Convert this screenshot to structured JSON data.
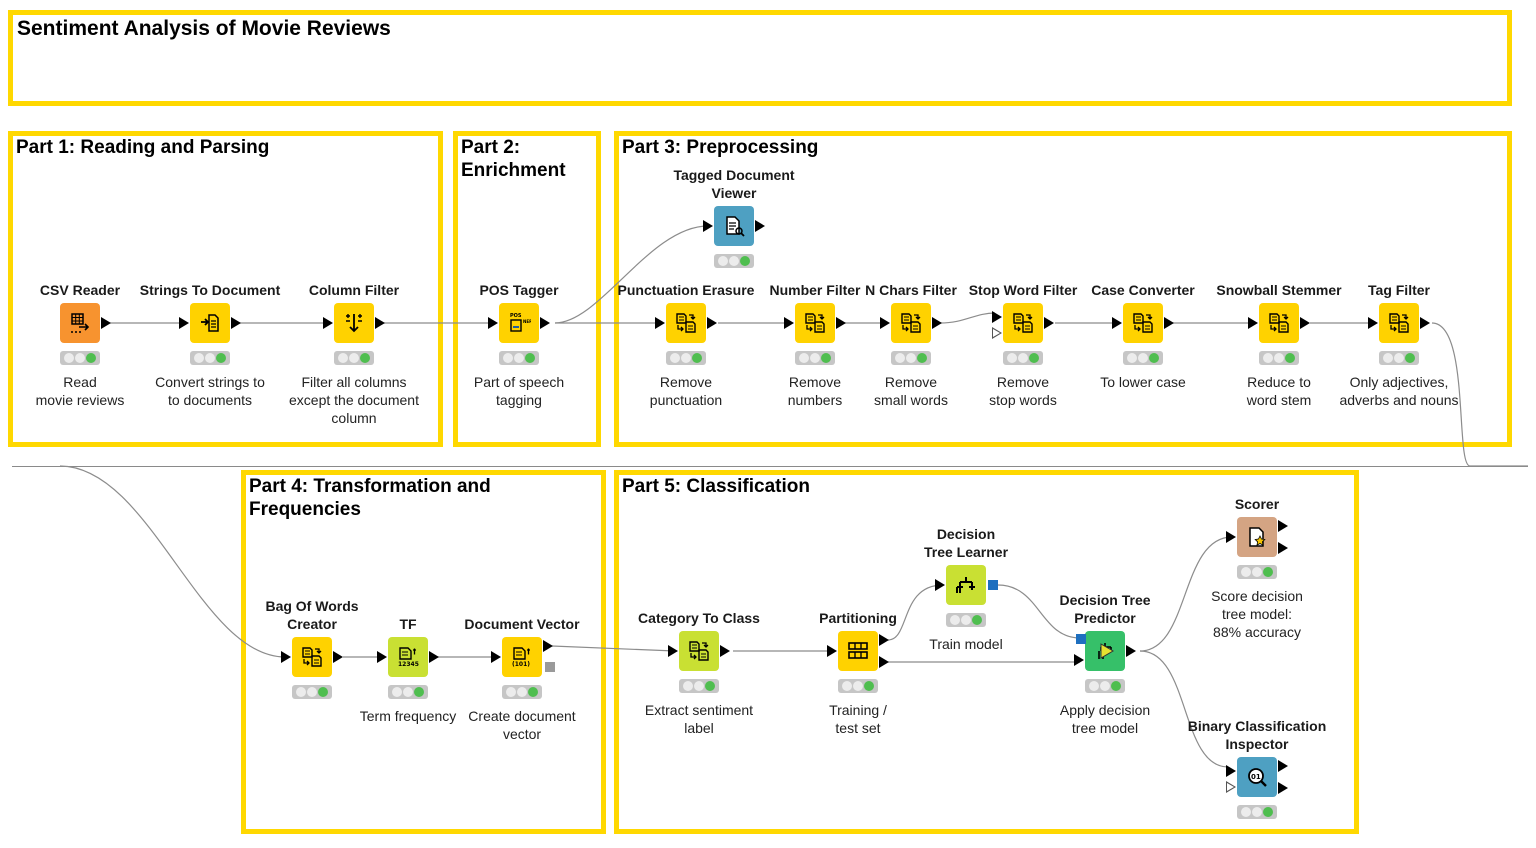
{
  "workflow": {
    "title": "Sentiment Analysis of Movie Reviews",
    "annotation_color": "#ffd800"
  },
  "annotations": [
    {
      "id": "main",
      "title": "Sentiment Analysis of Movie Reviews"
    },
    {
      "id": "part1",
      "title": "Part 1: Reading and Parsing"
    },
    {
      "id": "part2",
      "title": "Part 2:\nEnrichment"
    },
    {
      "id": "part3",
      "title": "Part 3: Preprocessing"
    },
    {
      "id": "part4",
      "title": "Part 4: Transformation and\nFrequencies"
    },
    {
      "id": "part5",
      "title": "Part 5: Classification"
    }
  ],
  "node_colors": {
    "source": "#f7932f",
    "manipulator": "#ffd200",
    "other": "#c9e033",
    "visualizer": "#4ea0c2",
    "predictor": "#36c069",
    "scorer": "#d4a483"
  },
  "nodes": [
    {
      "id": "csv-reader",
      "name": "CSV Reader",
      "desc": "Read\nmovie reviews",
      "type": "source",
      "icon": "table-arrow-icon",
      "status": "executed"
    },
    {
      "id": "strings-to-document",
      "name": "Strings To Document",
      "desc": "Convert strings to\nto documents",
      "type": "manipulator",
      "icon": "document-import-icon",
      "status": "executed"
    },
    {
      "id": "column-filter",
      "name": "Column Filter",
      "desc": "Filter all columns\nexcept the document\ncolumn",
      "type": "manipulator",
      "icon": "column-filter-icon",
      "status": "executed"
    },
    {
      "id": "pos-tagger",
      "name": "POS Tagger",
      "desc": "Part of speech\ntagging",
      "type": "manipulator",
      "icon": "pos-tag-icon",
      "status": "executed"
    },
    {
      "id": "tagged-document-viewer",
      "name": "Tagged Document\nViewer",
      "desc": "",
      "type": "visualizer",
      "icon": "document-view-icon",
      "status": "executed"
    },
    {
      "id": "punctuation-erasure",
      "name": "Punctuation Erasure",
      "desc": "Remove\npunctuation",
      "type": "manipulator",
      "icon": "document-transform-icon",
      "status": "executed"
    },
    {
      "id": "number-filter",
      "name": "Number Filter",
      "desc": "Remove\nnumbers",
      "type": "manipulator",
      "icon": "document-transform-icon",
      "status": "executed"
    },
    {
      "id": "n-chars-filter",
      "name": "N Chars Filter",
      "desc": "Remove\nsmall words",
      "type": "manipulator",
      "icon": "document-transform-icon",
      "status": "executed"
    },
    {
      "id": "stop-word-filter",
      "name": "Stop Word Filter",
      "desc": "Remove\nstop words",
      "type": "manipulator",
      "icon": "document-transform-icon",
      "status": "executed"
    },
    {
      "id": "case-converter",
      "name": "Case Converter",
      "desc": "To lower case",
      "type": "manipulator",
      "icon": "document-transform-icon",
      "status": "executed"
    },
    {
      "id": "snowball-stemmer",
      "name": "Snowball Stemmer",
      "desc": "Reduce to\nword stem",
      "type": "manipulator",
      "icon": "document-transform-icon",
      "status": "executed"
    },
    {
      "id": "tag-filter",
      "name": "Tag Filter",
      "desc": "Only adjectives,\nadverbs and nouns",
      "type": "manipulator",
      "icon": "document-transform-icon",
      "status": "executed"
    },
    {
      "id": "bag-of-words-creator",
      "name": "Bag Of Words\nCreator",
      "desc": "",
      "type": "manipulator",
      "icon": "document-transform-icon",
      "status": "executed"
    },
    {
      "id": "tf",
      "name": "TF",
      "desc": "Term frequency",
      "type": "other",
      "icon": "term-frequency-icon",
      "status": "executed"
    },
    {
      "id": "document-vector",
      "name": "Document Vector",
      "desc": "Create document\nvector",
      "type": "manipulator",
      "icon": "document-vector-icon",
      "status": "executed"
    },
    {
      "id": "category-to-class",
      "name": "Category To Class",
      "desc": "Extract sentiment\nlabel",
      "type": "other",
      "icon": "document-transform-icon",
      "status": "executed"
    },
    {
      "id": "partitioning",
      "name": "Partitioning",
      "desc": "Training /\ntest set",
      "type": "manipulator",
      "icon": "partition-icon",
      "status": "executed"
    },
    {
      "id": "decision-tree-learner",
      "name": "Decision\nTree Learner",
      "desc": "Train model",
      "type": "other",
      "icon": "decision-tree-icon",
      "status": "executed"
    },
    {
      "id": "decision-tree-predictor",
      "name": "Decision Tree\nPredictor",
      "desc": "Apply decision\ntree model",
      "type": "predictor",
      "icon": "predictor-icon",
      "status": "executed"
    },
    {
      "id": "scorer",
      "name": "Scorer",
      "desc": "Score decision\ntree model:\n88% accuracy",
      "type": "scorer",
      "icon": "scorer-icon",
      "status": "executed"
    },
    {
      "id": "binary-classification-inspector",
      "name": "Binary Classification\nInspector",
      "desc": "",
      "type": "visualizer",
      "icon": "inspector-icon",
      "status": "executed"
    }
  ]
}
